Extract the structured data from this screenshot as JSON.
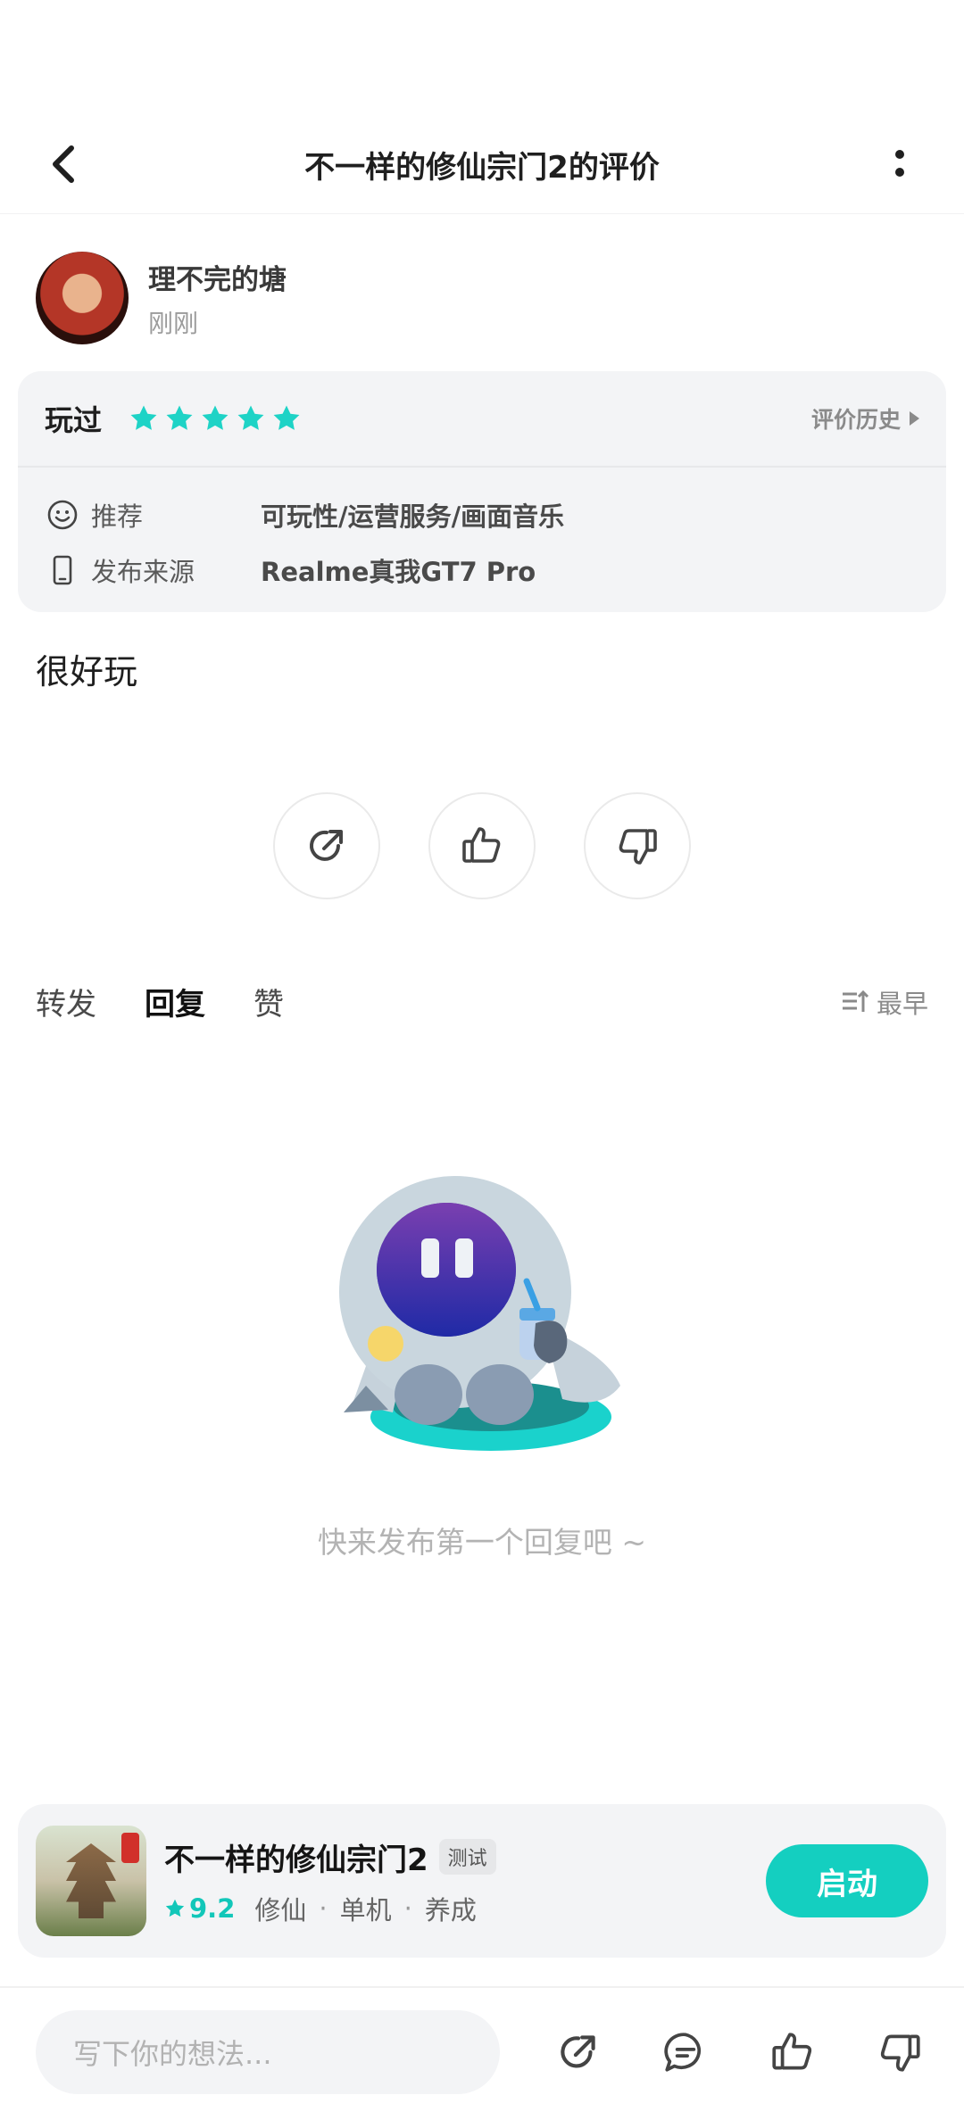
{
  "header": {
    "title": "不一样的修仙宗门2的评价",
    "back_icon": "back-arrow-icon",
    "more_icon": "more-vertical-icon"
  },
  "user": {
    "name": "理不完的塘",
    "time": "刚刚"
  },
  "review": {
    "status": "玩过",
    "rating": 5,
    "max_rating": 5,
    "history_label": "评价历史",
    "recommend_label": "推荐",
    "recommend_value": "可玩性/运营服务/画面音乐",
    "source_label": "发布来源",
    "source_value": "Realme真我GT7 Pro",
    "text": "很好玩"
  },
  "actions": [
    "share-icon",
    "thumbs-up-icon",
    "thumbs-down-icon"
  ],
  "tabs": [
    {
      "label": "转发",
      "active": false
    },
    {
      "label": "回复",
      "active": true
    },
    {
      "label": "赞",
      "active": false
    }
  ],
  "sort_label": "最早",
  "empty_text": "快来发布第一个回复吧 ~",
  "game": {
    "title": "不一样的修仙宗门2",
    "badge": "测试",
    "score": "9.2",
    "tags": [
      "修仙",
      "单机",
      "养成"
    ],
    "launch_label": "启动"
  },
  "bottom": {
    "placeholder": "写下你的想法..."
  },
  "colors": {
    "accent": "#14cfc0",
    "star": "#1ed3c6",
    "card_bg": "#f3f4f6"
  }
}
